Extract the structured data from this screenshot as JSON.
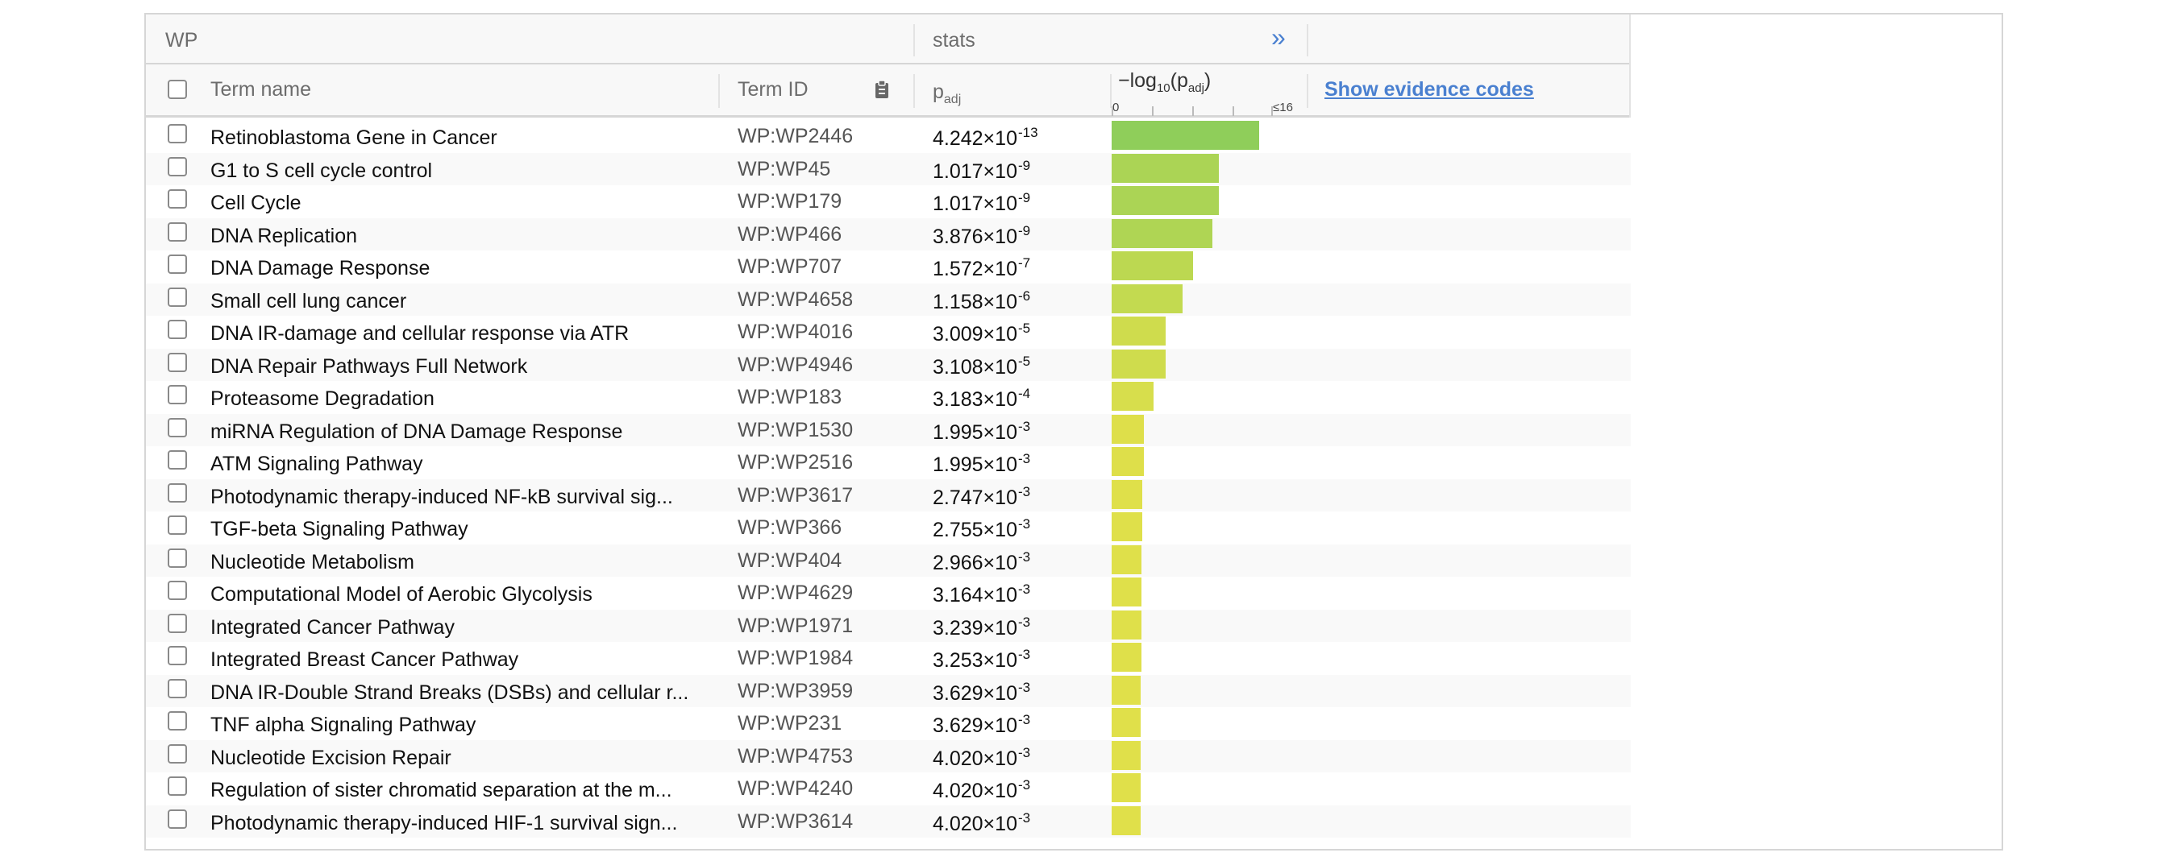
{
  "group_header": {
    "source": "WP",
    "stats": "stats",
    "expand_glyph": "»"
  },
  "columns": {
    "term_name": "Term name",
    "term_id": "Term ID",
    "p_adj_main": "p",
    "p_adj_sub": "adj",
    "neglog_prefix": "−log",
    "neglog_base": "10",
    "neglog_open": "(p",
    "neglog_sub": "adj",
    "neglog_close": ")",
    "axis_min": "0",
    "axis_max": "≤16",
    "evidence_link": "Show evidence codes"
  },
  "icons": {
    "copy": "clipboard-icon",
    "expand": "double-chevron-right-icon"
  },
  "colors": {
    "bar_high": "#8fce5a",
    "bar_low": "#e0e04a",
    "link": "#4a80d0"
  },
  "rows": [
    {
      "name": "Retinoblastoma Gene in Cancer",
      "id": "WP:WP2446",
      "p_mant": "4.242×10",
      "p_exp": "-13",
      "score": 12.37
    },
    {
      "name": "G1 to S cell cycle control",
      "id": "WP:WP45",
      "p_mant": "1.017×10",
      "p_exp": "-9",
      "score": 8.99
    },
    {
      "name": "Cell Cycle",
      "id": "WP:WP179",
      "p_mant": "1.017×10",
      "p_exp": "-9",
      "score": 8.99
    },
    {
      "name": "DNA Replication",
      "id": "WP:WP466",
      "p_mant": "3.876×10",
      "p_exp": "-9",
      "score": 8.41
    },
    {
      "name": "DNA Damage Response",
      "id": "WP:WP707",
      "p_mant": "1.572×10",
      "p_exp": "-7",
      "score": 6.8
    },
    {
      "name": "Small cell lung cancer",
      "id": "WP:WP4658",
      "p_mant": "1.158×10",
      "p_exp": "-6",
      "score": 5.94
    },
    {
      "name": "DNA IR-damage and cellular response via ATR",
      "id": "WP:WP4016",
      "p_mant": "3.009×10",
      "p_exp": "-5",
      "score": 4.52
    },
    {
      "name": "DNA Repair Pathways Full Network",
      "id": "WP:WP4946",
      "p_mant": "3.108×10",
      "p_exp": "-5",
      "score": 4.51
    },
    {
      "name": "Proteasome Degradation",
      "id": "WP:WP183",
      "p_mant": "3.183×10",
      "p_exp": "-4",
      "score": 3.5
    },
    {
      "name": "miRNA Regulation of DNA Damage Response",
      "id": "WP:WP1530",
      "p_mant": "1.995×10",
      "p_exp": "-3",
      "score": 2.7
    },
    {
      "name": "ATM Signaling Pathway",
      "id": "WP:WP2516",
      "p_mant": "1.995×10",
      "p_exp": "-3",
      "score": 2.7
    },
    {
      "name": "Photodynamic therapy-induced NF-kB survival sig...",
      "id": "WP:WP3617",
      "p_mant": "2.747×10",
      "p_exp": "-3",
      "score": 2.56
    },
    {
      "name": "TGF-beta Signaling Pathway",
      "id": "WP:WP366",
      "p_mant": "2.755×10",
      "p_exp": "-3",
      "score": 2.56
    },
    {
      "name": "Nucleotide Metabolism",
      "id": "WP:WP404",
      "p_mant": "2.966×10",
      "p_exp": "-3",
      "score": 2.53
    },
    {
      "name": "Computational Model of Aerobic Glycolysis",
      "id": "WP:WP4629",
      "p_mant": "3.164×10",
      "p_exp": "-3",
      "score": 2.5
    },
    {
      "name": "Integrated Cancer Pathway",
      "id": "WP:WP1971",
      "p_mant": "3.239×10",
      "p_exp": "-3",
      "score": 2.49
    },
    {
      "name": "Integrated Breast Cancer Pathway",
      "id": "WP:WP1984",
      "p_mant": "3.253×10",
      "p_exp": "-3",
      "score": 2.49
    },
    {
      "name": "DNA IR-Double Strand Breaks (DSBs) and cellular r...",
      "id": "WP:WP3959",
      "p_mant": "3.629×10",
      "p_exp": "-3",
      "score": 2.44
    },
    {
      "name": "TNF alpha Signaling Pathway",
      "id": "WP:WP231",
      "p_mant": "3.629×10",
      "p_exp": "-3",
      "score": 2.44
    },
    {
      "name": "Nucleotide Excision Repair",
      "id": "WP:WP4753",
      "p_mant": "4.020×10",
      "p_exp": "-3",
      "score": 2.4
    },
    {
      "name": "Regulation of sister chromatid separation at the m...",
      "id": "WP:WP4240",
      "p_mant": "4.020×10",
      "p_exp": "-3",
      "score": 2.4
    },
    {
      "name": "Photodynamic therapy-induced HIF-1 survival sign...",
      "id": "WP:WP3614",
      "p_mant": "4.020×10",
      "p_exp": "-3",
      "score": 2.4
    }
  ]
}
